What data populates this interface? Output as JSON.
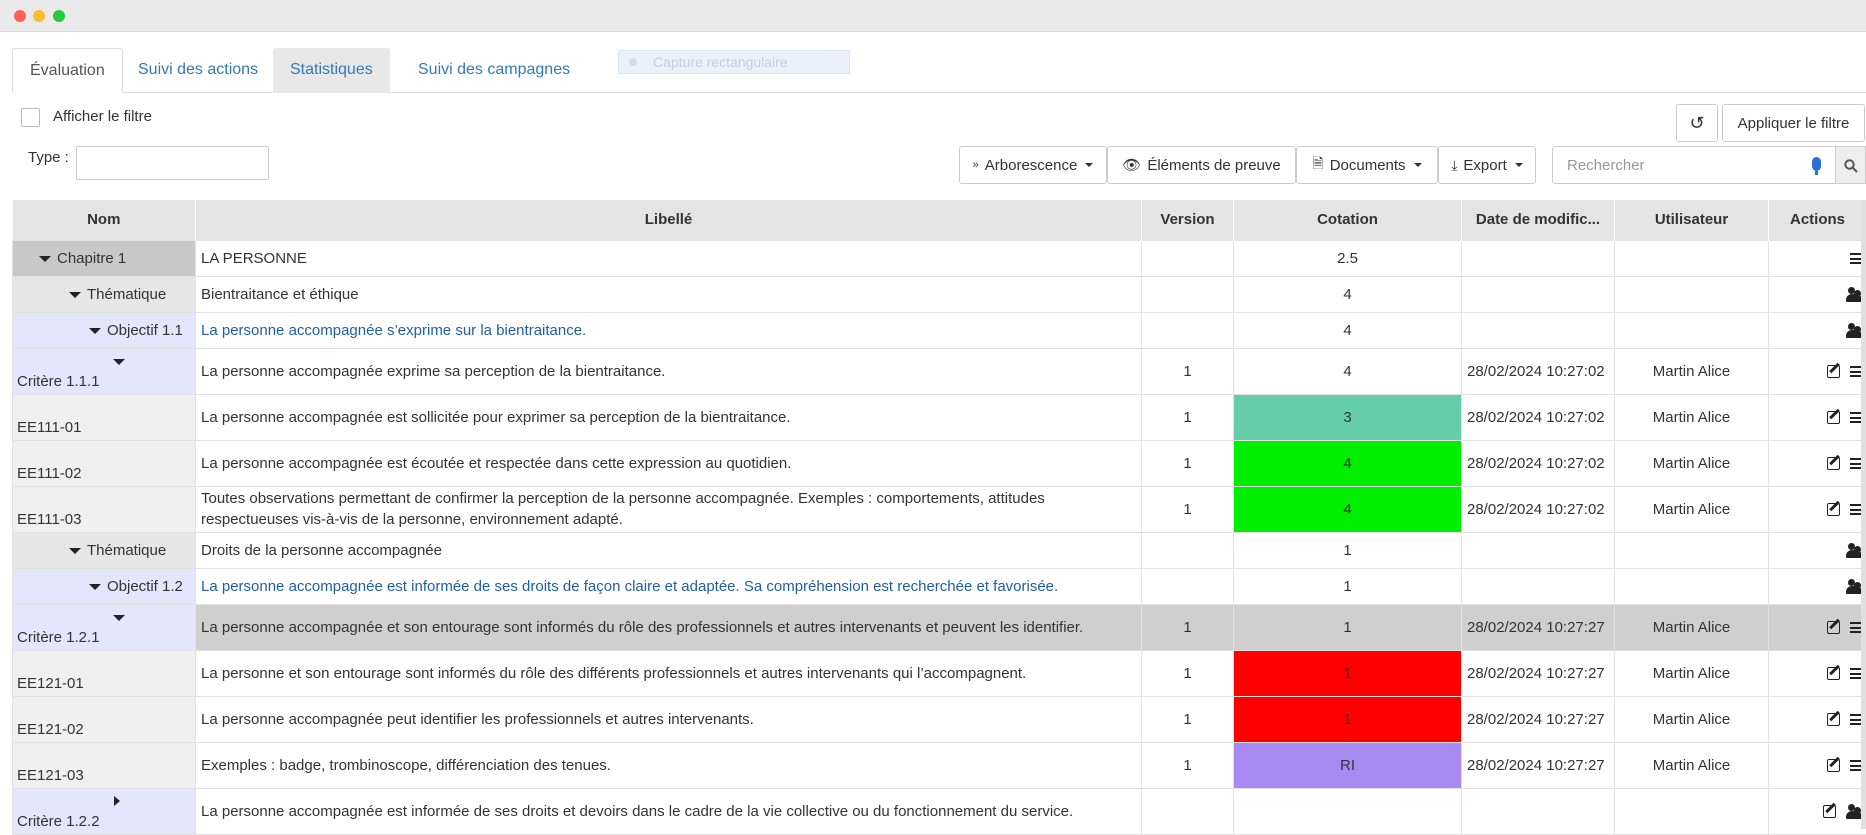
{
  "tabs": [
    {
      "label": "Évaluation"
    },
    {
      "label": "Suivi des actions"
    },
    {
      "label": "Statistiques"
    },
    {
      "label": "Suivi des campagnes"
    }
  ],
  "capture_hint": "Capture rectangulaire",
  "filter": {
    "checkbox_label": "Afficher le filtre",
    "apply_label": "Appliquer le filtre",
    "type_label": "Type :",
    "type_value": ""
  },
  "toolbar": {
    "tree_label": "Arborescence",
    "proof_label": "Éléments de preuve",
    "documents_label": "Documents",
    "export_label": "Export"
  },
  "search": {
    "placeholder": "Rechercher"
  },
  "table": {
    "columns": [
      "Nom",
      "Libellé",
      "Version",
      "Cotation",
      "Date de modific...",
      "Utilisateur",
      "Actions"
    ],
    "rows": [
      {
        "name": "Chapitre 1",
        "label": "LA PERSONNE",
        "version": "",
        "cotation": "2.5",
        "date": "",
        "user": ""
      },
      {
        "name": "Thématique",
        "label": "Bientraitance et éthique",
        "version": "",
        "cotation": "4",
        "date": "",
        "user": ""
      },
      {
        "name": "Objectif 1.1",
        "label": "La personne accompagnée s’exprime sur la bientraitance.",
        "version": "",
        "cotation": "4",
        "date": "",
        "user": ""
      },
      {
        "name": "Critère 1.1.1",
        "label": "La personne accompagnée exprime sa perception de la bientraitance.",
        "version": "1",
        "cotation": "4",
        "date": "28/02/2024 10:27:02",
        "user": "Martin Alice"
      },
      {
        "name": "EE111-01",
        "label": "La personne accompagnée est sollicitée pour exprimer sa perception de la bientraitance.",
        "version": "1",
        "cotation": "3",
        "date": "28/02/2024 10:27:02",
        "user": "Martin Alice"
      },
      {
        "name": "EE111-02",
        "label": "La personne accompagnée est écoutée et respectée dans cette expression au quotidien.",
        "version": "1",
        "cotation": "4",
        "date": "28/02/2024 10:27:02",
        "user": "Martin Alice"
      },
      {
        "name": "EE111-03",
        "label": "Toutes observations permettant de confirmer la perception de  la personne accompagnée. Exemples : comportements,  attitudes respectueuses vis-à-vis de la personne,  environnement adapté.",
        "version": "1",
        "cotation": "4",
        "date": "28/02/2024 10:27:02",
        "user": "Martin Alice"
      },
      {
        "name": "Thématique",
        "label": "Droits de la personne accompagnée",
        "version": "",
        "cotation": "1",
        "date": "",
        "user": ""
      },
      {
        "name": "Objectif 1.2",
        "label": "La personne accompagnée est informée de ses  droits de façon claire et adaptée. Sa compréhension est  recherchée et favorisée.",
        "version": "",
        "cotation": "1",
        "date": "",
        "user": ""
      },
      {
        "name": "Critère 1.2.1",
        "label": "La personne accompagnée et son entourage sont informés du  rôle des professionnels et autres intervenants et peuvent les identifier.",
        "version": "1",
        "cotation": "1",
        "date": "28/02/2024 10:27:27",
        "user": "Martin Alice"
      },
      {
        "name": "EE121-01",
        "label": "La personne et son entourage sont informés du rôle des  différents professionnels et autres intervenants qui  l’accompagnent.",
        "version": "1",
        "cotation": "1",
        "date": "28/02/2024 10:27:27",
        "user": "Martin Alice"
      },
      {
        "name": "EE121-02",
        "label": "La personne accompagnée peut identifier les professionnels  et autres intervenants.",
        "version": "1",
        "cotation": "1",
        "date": "28/02/2024 10:27:27",
        "user": "Martin Alice"
      },
      {
        "name": "EE121-03",
        "label": "Exemples : badge, trombinoscope, différenciation des  tenues.",
        "version": "1",
        "cotation": "RI",
        "date": "28/02/2024 10:27:27",
        "user": "Martin Alice"
      },
      {
        "name": "Critère 1.2.2",
        "label": "La personne accompagnée est informée de ses droits et  devoirs dans le cadre de la vie collective ou du fonctionnement du service.",
        "version": "",
        "cotation": "",
        "date": "",
        "user": ""
      }
    ]
  },
  "colors": {
    "teal": "#66cdaa",
    "green": "#00ee00",
    "red": "#ff0000",
    "purple": "#a989f2",
    "chapter_bg": "#c8c8c8",
    "theme_bg": "#e6e6e6",
    "lavender_bg": "#e4e6fb",
    "selected_bg": "#cfcfcf"
  }
}
